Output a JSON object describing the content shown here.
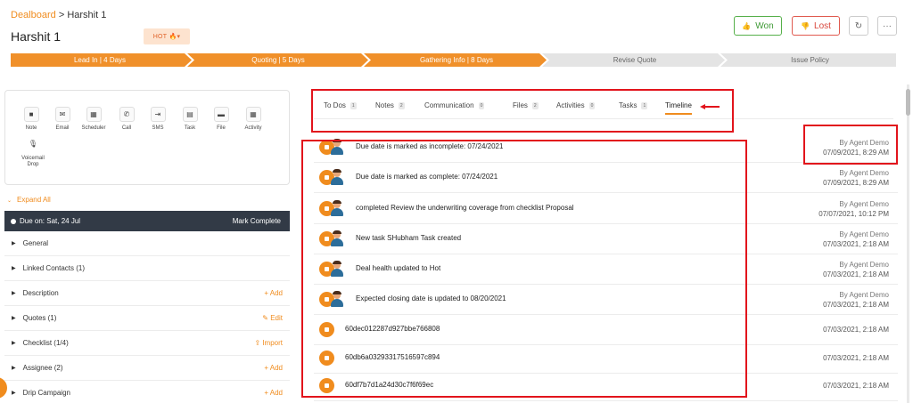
{
  "header": {
    "breadcrumb_root": "Dealboard",
    "breadcrumb_sep": ">",
    "breadcrumb_current": "Harshit 1",
    "title": "Harshit 1",
    "hot_badge": "HOT 🔥▾",
    "won_label": "Won",
    "lost_label": "Lost",
    "refresh_icon": "↻",
    "more_icon": "···",
    "won_icon": "👍",
    "lost_icon": "👎"
  },
  "pipeline": [
    {
      "label": "Lead In | 4 Days",
      "active": true
    },
    {
      "label": "Quoting | 5 Days",
      "active": true
    },
    {
      "label": "Gathering Info | 8 Days",
      "active": true
    },
    {
      "label": "Revise Quote",
      "active": false
    },
    {
      "label": "Issue Policy",
      "active": false
    }
  ],
  "actions": [
    {
      "label": "Note",
      "icon": "note-icon",
      "glyph": "■"
    },
    {
      "label": "Email",
      "icon": "email-icon",
      "glyph": "✉"
    },
    {
      "label": "Scheduler",
      "icon": "calendar-icon",
      "glyph": "▦"
    },
    {
      "label": "Call",
      "icon": "phone-icon",
      "glyph": "✆"
    },
    {
      "label": "SMS",
      "icon": "sms-icon",
      "glyph": "⇥"
    },
    {
      "label": "Task",
      "icon": "task-icon",
      "glyph": "▤"
    },
    {
      "label": "File",
      "icon": "folder-icon",
      "glyph": "▬"
    },
    {
      "label": "Activity",
      "icon": "calendar-icon",
      "glyph": "▦"
    },
    {
      "label": "Voicemail Drop",
      "icon": "mic-icon",
      "glyph": "🎙"
    }
  ],
  "expand_all": "Expand All",
  "due": {
    "label": "Due on: Sat, 24 Jul",
    "action": "Mark Complete"
  },
  "sections": [
    {
      "label": "General",
      "action": ""
    },
    {
      "label": "Linked Contacts (1)",
      "action": ""
    },
    {
      "label": "Description",
      "action": "+ Add"
    },
    {
      "label": "Quotes (1)",
      "action": "✎ Edit"
    },
    {
      "label": "Checklist (1/4)",
      "action": "⇪ Import"
    },
    {
      "label": "Assignee (2)",
      "action": "+ Add"
    },
    {
      "label": "Drip Campaign",
      "action": "+ Add"
    }
  ],
  "tabs": [
    {
      "label": "To Dos",
      "count": "1",
      "active": false
    },
    {
      "label": "Notes",
      "count": "2",
      "active": false
    },
    {
      "label": "Communication",
      "count": "0",
      "active": false
    },
    {
      "label": "Files",
      "count": "2",
      "active": false
    },
    {
      "label": "Activities",
      "count": "0",
      "active": false
    },
    {
      "label": "Tasks",
      "count": "1",
      "active": false
    },
    {
      "label": "Timeline",
      "count": "",
      "active": true
    }
  ],
  "timeline": [
    {
      "text": "Due date is marked as incomplete: 07/24/2021",
      "agent": "By Agent Demo",
      "time": "07/09/2021, 8:29 AM",
      "avatar": true
    },
    {
      "text": "Due date is marked as complete: 07/24/2021",
      "agent": "By Agent Demo",
      "time": "07/09/2021, 8:29 AM",
      "avatar": true
    },
    {
      "text": "completed Review the underwriting coverage from checklist Proposal",
      "agent": "By Agent Demo",
      "time": "07/07/2021, 10:12 PM",
      "avatar": true
    },
    {
      "text": "New task SHubham Task created",
      "agent": "By Agent Demo",
      "time": "07/03/2021, 2:18 AM",
      "avatar": true
    },
    {
      "text": "Deal health updated to Hot",
      "agent": "By Agent Demo",
      "time": "07/03/2021, 2:18 AM",
      "avatar": true
    },
    {
      "text": "Expected closing date is updated to 08/20/2021",
      "agent": "By Agent Demo",
      "time": "07/03/2021, 2:18 AM",
      "avatar": true
    },
    {
      "text": "60dec012287d927bbe766808",
      "agent": "",
      "time": "07/03/2021, 2:18 AM",
      "avatar": false
    },
    {
      "text": "60db6a03293317516597c894",
      "agent": "",
      "time": "07/03/2021, 2:18 AM",
      "avatar": false
    },
    {
      "text": "60df7b7d1a24d30c7f6f69ec",
      "agent": "",
      "time": "07/03/2021, 2:18 AM",
      "avatar": false
    }
  ],
  "colors": {
    "accent": "#f08c1e",
    "highlight": "#e2141c",
    "dark_bar": "#323a46"
  }
}
